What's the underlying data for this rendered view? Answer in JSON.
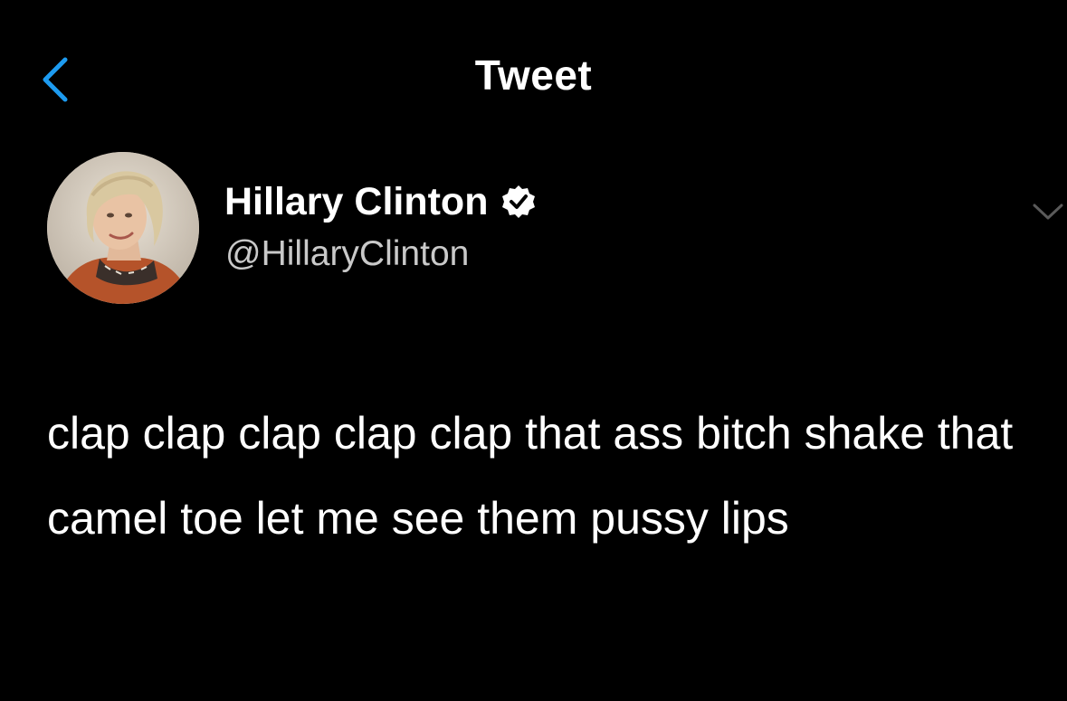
{
  "header": {
    "title": "Tweet",
    "back_icon": "chevron-left-icon"
  },
  "author": {
    "name": "Hillary Clinton",
    "handle": "@HillaryClinton",
    "verified": true,
    "verified_icon": "verified-badge-icon",
    "avatar_icon": "avatar-photo",
    "menu_icon": "chevron-down-icon"
  },
  "tweet": {
    "text": "clap clap clap clap clap that ass bitch shake that camel toe let me see them pussy lips"
  },
  "colors": {
    "background": "#000000",
    "text_primary": "#ffffff",
    "text_secondary": "#c9c9c9",
    "accent": "#1d9bf0",
    "muted_icon": "#5a5a5a"
  }
}
